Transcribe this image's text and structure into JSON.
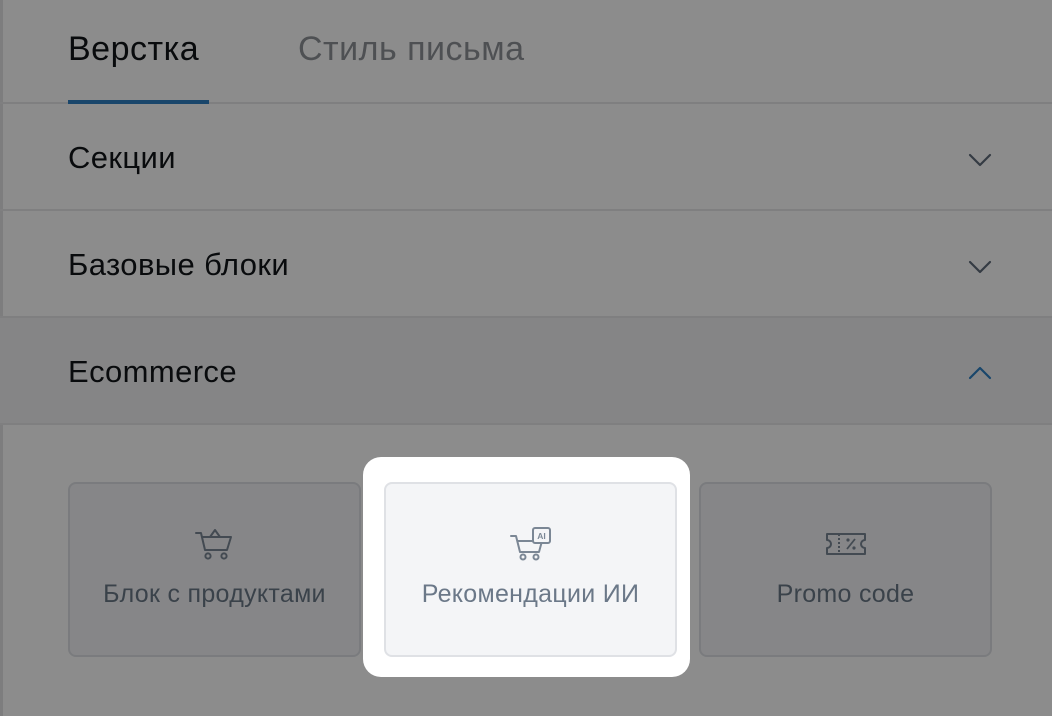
{
  "tabs": {
    "layout": "Верстка",
    "style": "Стиль письма"
  },
  "accordion": {
    "sections": "Секции",
    "base_blocks": "Базовые блоки",
    "ecommerce": "Ecommerce"
  },
  "ecommerce_blocks": {
    "products": "Блок с продуктами",
    "ai_recommendations": "Рекомендации ИИ",
    "promo_code": "Promo code"
  },
  "icons": {
    "products": "cart-icon",
    "ai_recommendations": "ai-cart-icon",
    "promo_code": "ticket-percent-icon",
    "collapsed": "chevron-down-icon",
    "expanded": "chevron-up-icon"
  },
  "colors": {
    "accent": "#2f80c4",
    "text_primary": "#111418",
    "text_muted": "#8f9398",
    "card_caption": "#6b7888",
    "overlay": "rgba(0,0,0,0.45)"
  }
}
